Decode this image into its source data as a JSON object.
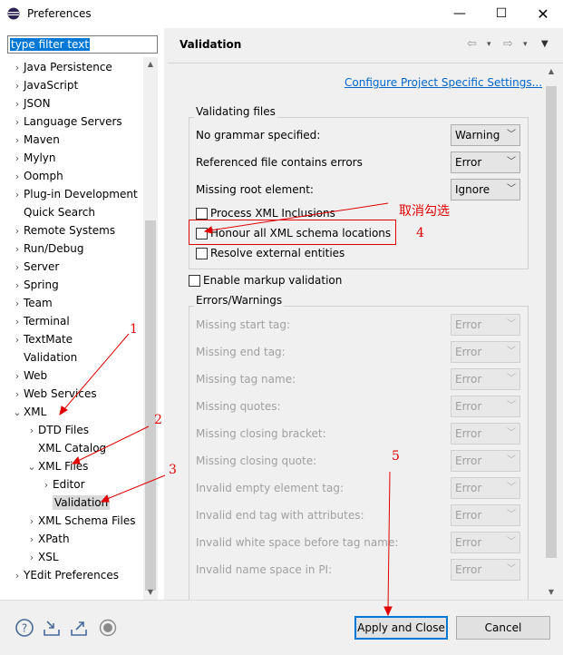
{
  "window": {
    "title": "Preferences"
  },
  "filter": {
    "text": "type filter text"
  },
  "tree": [
    {
      "label": "Java Persistence",
      "indent": 0,
      "arrow": "›"
    },
    {
      "label": "JavaScript",
      "indent": 0,
      "arrow": "›"
    },
    {
      "label": "JSON",
      "indent": 0,
      "arrow": "›"
    },
    {
      "label": "Language Servers",
      "indent": 0,
      "arrow": "›"
    },
    {
      "label": "Maven",
      "indent": 0,
      "arrow": "›"
    },
    {
      "label": "Mylyn",
      "indent": 0,
      "arrow": "›"
    },
    {
      "label": "Oomph",
      "indent": 0,
      "arrow": "›"
    },
    {
      "label": "Plug-in Development",
      "indent": 0,
      "arrow": "›"
    },
    {
      "label": "Quick Search",
      "indent": 0,
      "arrow": ""
    },
    {
      "label": "Remote Systems",
      "indent": 0,
      "arrow": "›"
    },
    {
      "label": "Run/Debug",
      "indent": 0,
      "arrow": "›"
    },
    {
      "label": "Server",
      "indent": 0,
      "arrow": "›"
    },
    {
      "label": "Spring",
      "indent": 0,
      "arrow": "›"
    },
    {
      "label": "Team",
      "indent": 0,
      "arrow": "›"
    },
    {
      "label": "Terminal",
      "indent": 0,
      "arrow": "›"
    },
    {
      "label": "TextMate",
      "indent": 0,
      "arrow": "›"
    },
    {
      "label": "Validation",
      "indent": 0,
      "arrow": ""
    },
    {
      "label": "Web",
      "indent": 0,
      "arrow": "›"
    },
    {
      "label": "Web Services",
      "indent": 0,
      "arrow": "›"
    },
    {
      "label": "XML",
      "indent": 0,
      "arrow": "⌄"
    },
    {
      "label": "DTD Files",
      "indent": 1,
      "arrow": "›"
    },
    {
      "label": "XML Catalog",
      "indent": 1,
      "arrow": ""
    },
    {
      "label": "XML Files",
      "indent": 1,
      "arrow": "⌄"
    },
    {
      "label": "Editor",
      "indent": 2,
      "arrow": "›"
    },
    {
      "label": "Validation",
      "indent": 2,
      "arrow": "",
      "selected": true
    },
    {
      "label": "XML Schema Files",
      "indent": 1,
      "arrow": "›"
    },
    {
      "label": "XPath",
      "indent": 1,
      "arrow": "›"
    },
    {
      "label": "XSL",
      "indent": 1,
      "arrow": "›"
    },
    {
      "label": "YEdit Preferences",
      "indent": 0,
      "arrow": "›"
    }
  ],
  "page": {
    "title": "Validation",
    "config_link": "Configure Project Specific Settings...",
    "validating_group": "Validating files",
    "rows": [
      {
        "label": "No grammar specified:",
        "value": "Warning"
      },
      {
        "label": "Referenced file contains errors",
        "value": "Error"
      },
      {
        "label": "Missing root element:",
        "value": "Ignore"
      }
    ],
    "checks": [
      {
        "label": "Process XML Inclusions"
      },
      {
        "label": "Honour all XML schema locations"
      },
      {
        "label": "Resolve external entities"
      }
    ],
    "markup_check": "Enable markup validation",
    "errors_group": "Errors/Warnings",
    "error_rows": [
      {
        "label": "Missing start tag:",
        "value": "Error"
      },
      {
        "label": "Missing end tag:",
        "value": "Error"
      },
      {
        "label": "Missing tag name:",
        "value": "Error"
      },
      {
        "label": "Missing quotes:",
        "value": "Error"
      },
      {
        "label": "Missing closing bracket:",
        "value": "Error"
      },
      {
        "label": "Missing closing quote:",
        "value": "Error"
      },
      {
        "label": "Invalid empty element tag:",
        "value": "Error"
      },
      {
        "label": "Invalid end tag with attributes:",
        "value": "Error"
      },
      {
        "label": "Invalid white space before tag name:",
        "value": "Error"
      },
      {
        "label": "Invalid name space in PI:",
        "value": "Error"
      }
    ]
  },
  "buttons": {
    "apply_close": "Apply and Close",
    "cancel": "Cancel"
  },
  "icons": [
    "help-icon",
    "import-icon",
    "export-icon",
    "record-icon"
  ],
  "annotations": {
    "n1": "1",
    "n2": "2",
    "n3": "3",
    "n4": "4",
    "n5": "5",
    "note": "取消勾选",
    "color": "#e00000"
  }
}
